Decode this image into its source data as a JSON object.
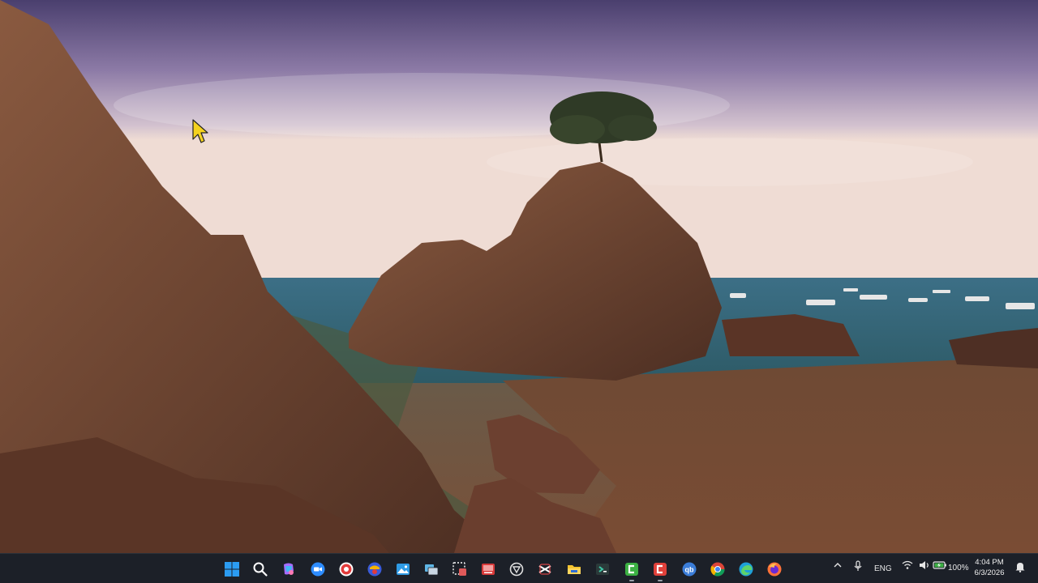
{
  "desktop": {
    "wallpaper_icon": "coastal-rock-landscape",
    "cursor_icon": "arrow-pointer-icon"
  },
  "taskbar": {
    "apps": [
      {
        "name": "start-button",
        "icon": "windows-logo-icon",
        "color": "#2b9cf2",
        "running": false
      },
      {
        "name": "search-button",
        "icon": "search-icon",
        "color": "#ffffff",
        "running": false
      },
      {
        "name": "copilot-app",
        "icon": "copilot-icon",
        "color": "#a66cff",
        "running": false
      },
      {
        "name": "zoom-app",
        "icon": "zoom-camera-icon",
        "color": "#2d8cff",
        "running": false
      },
      {
        "name": "screen-recorder-app",
        "icon": "record-icon",
        "color": "#e23b3b",
        "running": false
      },
      {
        "name": "media-player-app",
        "icon": "media-play-icon",
        "color": "#3a5bd9",
        "running": false
      },
      {
        "name": "photos-app",
        "icon": "photos-icon",
        "color": "#2e9be6",
        "running": false
      },
      {
        "name": "taskview-app",
        "icon": "window-stack-icon",
        "color": "#5fb6e6",
        "running": false
      },
      {
        "name": "snipping-tool-app",
        "icon": "scissors-icon",
        "color": "#e05a5a",
        "running": false
      },
      {
        "name": "presentation-app",
        "icon": "slides-icon",
        "color": "#d83a3a",
        "running": false
      },
      {
        "name": "openai-app",
        "icon": "chatgpt-icon",
        "color": "#e0e0e0",
        "running": false
      },
      {
        "name": "capcut-app",
        "icon": "capcut-icon",
        "color": "#ffffff",
        "running": false
      },
      {
        "name": "file-explorer-app",
        "icon": "folder-icon",
        "color": "#f4c430",
        "running": false
      },
      {
        "name": "terminal-app",
        "icon": "terminal-icon",
        "color": "#3ec7a6",
        "running": false
      },
      {
        "name": "camtasia-app",
        "icon": "camtasia-green-icon",
        "color": "#3cb043",
        "running": true
      },
      {
        "name": "camtasia-recorder-app",
        "icon": "camtasia-red-icon",
        "color": "#e0403a",
        "running": true
      },
      {
        "name": "qbittorrent-app",
        "icon": "qbittorrent-icon",
        "color": "#3b7dd8",
        "running": false
      },
      {
        "name": "chrome-app",
        "icon": "chrome-icon",
        "color": "#4285f4",
        "running": false
      },
      {
        "name": "edge-app",
        "icon": "edge-icon",
        "color": "#1fa0d8",
        "running": false
      },
      {
        "name": "firefox-app",
        "icon": "firefox-icon",
        "color": "#ff7139",
        "running": false
      }
    ],
    "tray": {
      "chevron_icon": "chevron-up-icon",
      "mic_icon": "microphone-icon",
      "language": "ENG",
      "wifi_icon": "wifi-icon",
      "volume_icon": "speaker-icon",
      "battery_icon": "battery-charging-icon",
      "battery": "100%",
      "time": "4:04 PM",
      "date": "6/3/2026",
      "notification_icon": "notification-bell-icon"
    }
  }
}
